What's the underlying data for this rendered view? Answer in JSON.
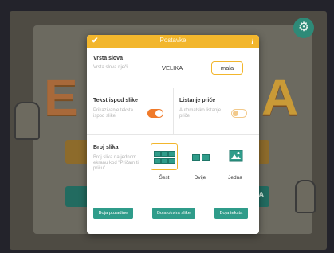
{
  "dialog": {
    "title": "Postavke",
    "check_icon": "✔",
    "info_icon": "i"
  },
  "font": {
    "label": "Vrsta slova",
    "sublabel": "Vrsta slova riječi",
    "option_upper": "VELIKA",
    "option_lower": "mala",
    "selected": "mala"
  },
  "caption": {
    "label": "Tekst ispod slike",
    "sublabel": "Prikazivanje teksta ispod slike",
    "enabled": true
  },
  "autoplay": {
    "label": "Listanje priče",
    "sublabel": "Automatsko listanje priče",
    "enabled": false
  },
  "image_count": {
    "label": "Broj slika",
    "sublabel": "Broj slika na jednom ekranu kod \"Pričam ti priču\"",
    "options": [
      {
        "label": "Šest",
        "icon": "six-grid-icon"
      },
      {
        "label": "Dvije",
        "icon": "two-grid-icon"
      },
      {
        "label": "Jedna",
        "icon": "single-image-icon"
      }
    ],
    "selected": "Šest"
  },
  "color_buttons": {
    "background": "Boja pozadine",
    "frame": "Boja okvira slike",
    "text": "Boja teksta"
  },
  "background_app": {
    "settings_icon": "⚙",
    "title_left": "E",
    "title_right": "A",
    "teal_button_fragment": "ZA"
  },
  "colors": {
    "accent": "#f2b62d",
    "teal": "#2f9c8a",
    "toggle_on": "#f07a2a"
  }
}
